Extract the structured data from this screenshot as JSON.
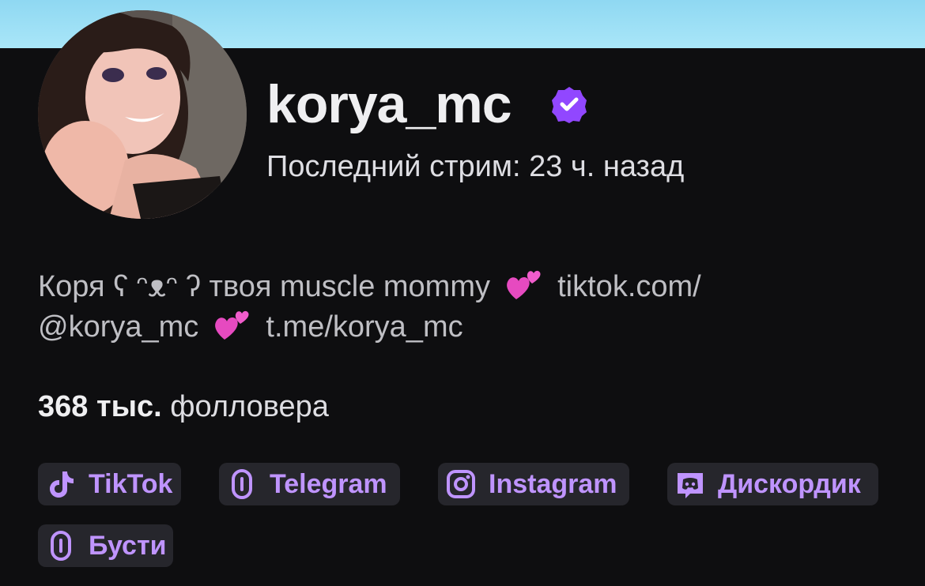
{
  "profile": {
    "username": "korya_mc",
    "verified": true,
    "last_stream": "Последний стрим: 23 ч. назад",
    "bio_line1_a": "Коря ʕ ᵔᴥᵔ ʔ твоя muscle mommy",
    "bio_line1_b": "tiktok.com/",
    "bio_line2_a": "@korya_mc",
    "bio_line2_b": "t.me/korya_mc",
    "followers_count": "368 тыс.",
    "followers_label": "фолловера"
  },
  "links": [
    {
      "label": "TikTok",
      "icon": "tiktok-icon"
    },
    {
      "label": "Telegram",
      "icon": "link-icon"
    },
    {
      "label": "Instagram",
      "icon": "instagram-icon"
    },
    {
      "label": "Дискордик",
      "icon": "discord-icon"
    },
    {
      "label": "Бусти",
      "icon": "link-icon"
    }
  ],
  "colors": {
    "accent": "#bf94ff",
    "verified": "#9147ff",
    "banner": "#a9e6f8",
    "background": "#0e0e10",
    "heart": "#e64ac0"
  }
}
